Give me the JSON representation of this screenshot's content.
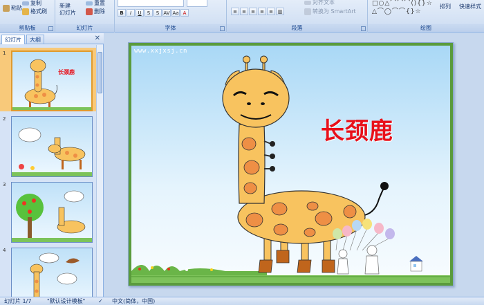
{
  "ribbon": {
    "groups": {
      "clipboard": "剪贴板",
      "slides": "幻灯片",
      "font": "字体",
      "paragraph": "段落",
      "drawing": "绘图"
    },
    "paste": "粘贴",
    "copy": "复制",
    "format_painter": "格式刷",
    "new_slide": "新建",
    "new_slide_line2": "幻灯片",
    "reset": "重置",
    "delete": "删除",
    "align_text": "对齐文本",
    "convert_smartart": "转换为 SmartArt",
    "arrange": "排列",
    "quick_styles": "快速样式"
  },
  "pane": {
    "tab_slides": "幻灯片",
    "tab_outline": "大纲",
    "close": "✕",
    "slides": [
      {
        "num": "1",
        "title": "长颈鹿"
      },
      {
        "num": "2"
      },
      {
        "num": "3"
      },
      {
        "num": "4"
      }
    ]
  },
  "slide": {
    "watermark": "www.xxjxsj.cn",
    "title": "长颈鹿",
    "title_color": "#e8101a"
  },
  "status": {
    "slide_info": "幻灯片 1/7",
    "theme": "\"默认设计模板\"",
    "language": "中文(简体，中国)"
  },
  "colors": {
    "giraffe_body": "#f8c35f",
    "giraffe_spot": "#ee8f45",
    "hoof": "#c0651c"
  }
}
